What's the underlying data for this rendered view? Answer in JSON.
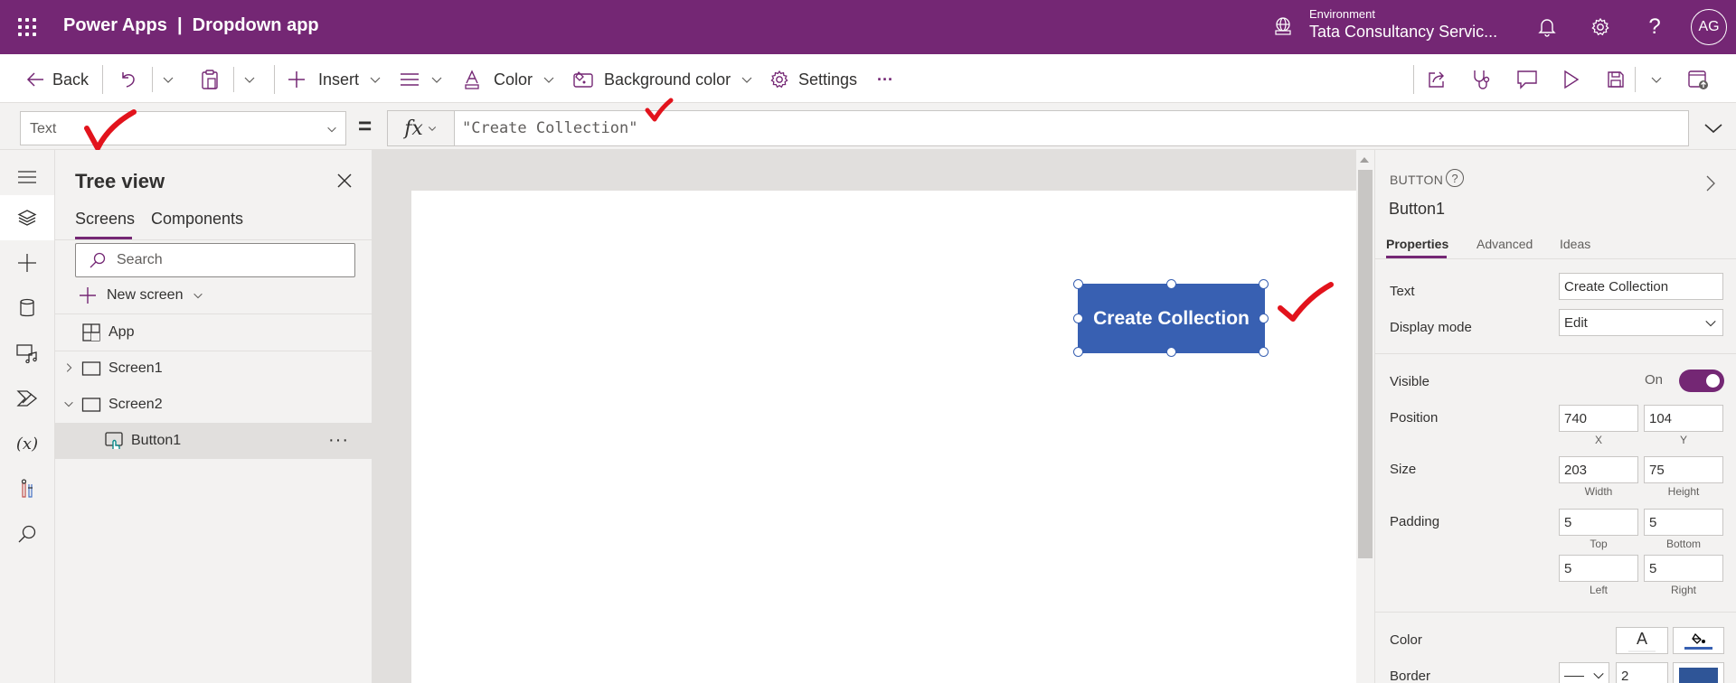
{
  "header": {
    "app_title": "Power Apps  |  Dropdown app",
    "environment_label": "Environment",
    "environment_value": "Tata Consultancy Servic...",
    "avatar_initials": "AG",
    "brand_color": "#742774"
  },
  "command_bar": {
    "back": "Back",
    "insert": "Insert",
    "color": "Color",
    "background_color": "Background color",
    "settings": "Settings",
    "more": "···"
  },
  "formula_bar": {
    "property": "Text",
    "equals": "=",
    "fx_label": "fx",
    "formula": "\"Create Collection\""
  },
  "tree_view": {
    "title": "Tree view",
    "tabs": [
      "Screens",
      "Components"
    ],
    "active_tab": "Screens",
    "search_placeholder": "Search",
    "new_screen": "New screen",
    "items": [
      {
        "label": "App",
        "type": "app"
      },
      {
        "label": "Screen1",
        "type": "screen",
        "expanded": false
      },
      {
        "label": "Screen2",
        "type": "screen",
        "expanded": true
      },
      {
        "label": "Button1",
        "type": "button",
        "selected": true
      }
    ],
    "more": "···"
  },
  "canvas": {
    "button_text": "Create Collection",
    "button_color": "#3860b2"
  },
  "properties_panel": {
    "control_type": "BUTTON",
    "help": "?",
    "control_name": "Button1",
    "tabs": [
      "Properties",
      "Advanced",
      "Ideas"
    ],
    "active_tab": "Properties",
    "text_label": "Text",
    "text_value": "Create Collection",
    "display_mode_label": "Display mode",
    "display_mode_value": "Edit",
    "visible_label": "Visible",
    "visible_value": "On",
    "position_label": "Position",
    "position_x": "740",
    "position_y": "104",
    "x_label": "X",
    "y_label": "Y",
    "size_label": "Size",
    "size_width": "203",
    "size_height": "75",
    "width_label": "Width",
    "height_label": "Height",
    "padding_label": "Padding",
    "padding_top": "5",
    "padding_bottom": "5",
    "padding_left": "5",
    "padding_right": "5",
    "top_label": "Top",
    "bottom_label": "Bottom",
    "left_label": "Left",
    "right_label": "Right",
    "color_label": "Color",
    "color_text_glyph": "A",
    "border_label": "Border",
    "border_width": "2",
    "border_color": "#2f5597"
  }
}
